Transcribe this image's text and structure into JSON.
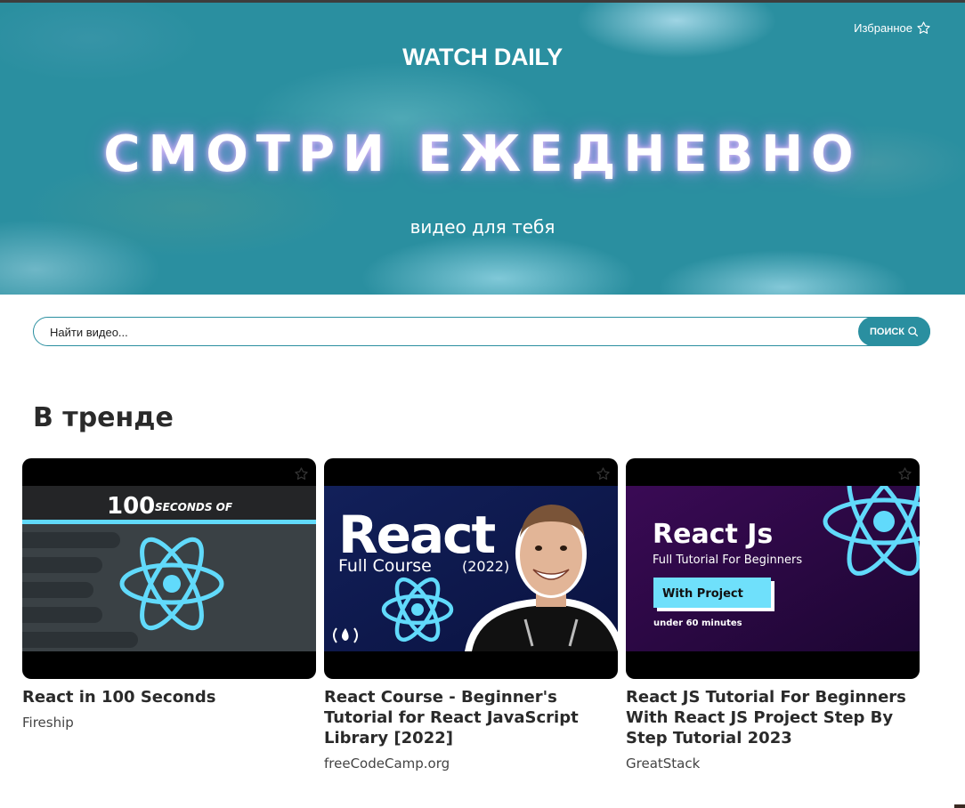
{
  "header": {
    "favorites_label": "Избранное",
    "brand": "WATCH DAILY",
    "title": "СМОТРИ ЕЖЕДНЕВНО",
    "subtitle": "видео для тебя"
  },
  "search": {
    "placeholder": "Найти видео...",
    "button_label": "ПОИСК"
  },
  "section": {
    "title": "В тренде"
  },
  "videos": [
    {
      "title": "React in 100 Seconds",
      "channel": "Fireship",
      "thumb": {
        "heading": "100",
        "heading_small": "SECONDS OF"
      }
    },
    {
      "title": "React Course - Beginner's Tutorial for React JavaScript Library [2022]",
      "channel": "freeCodeCamp.org",
      "thumb": {
        "heading": "React",
        "subheading": "Full Course",
        "year": "(2022)"
      }
    },
    {
      "title": "React JS Tutorial For Beginners With React JS Project Step By Step Tutorial 2023",
      "channel": "GreatStack",
      "thumb": {
        "heading": "React Js",
        "subheading": "Full Tutorial For Beginners",
        "badge": "With Project",
        "note": "under 60 minutes"
      }
    }
  ],
  "colors": {
    "accent": "#2a8fa0",
    "react_blue": "#61dafb"
  },
  "icons": {
    "favorite": "star-outline-icon",
    "search": "search-icon"
  }
}
